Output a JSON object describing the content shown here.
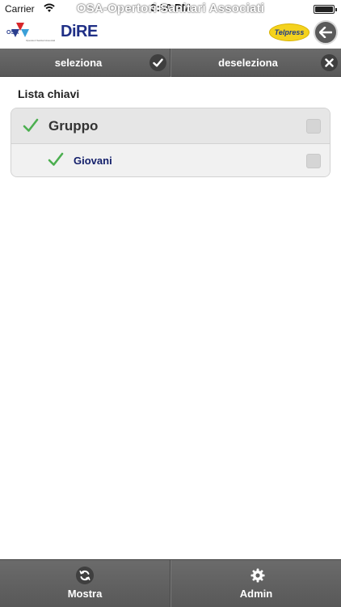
{
  "status_bar": {
    "carrier": "Carrier",
    "time": "3:50 PM",
    "wifi_icon": "wifi-icon",
    "battery_icon": "battery-icon"
  },
  "app": {
    "title": "OSA-Opertori Sanitari Associati"
  },
  "header": {
    "logo_osa_text": "OSA",
    "logo_osa_subtitle": "Operatori Sanitari Associati",
    "logo_dire_text": "DiRE",
    "logo_telpress_text": "Telpress",
    "back_icon": "arrow-left-icon"
  },
  "toolbar": {
    "select_label": "seleziona",
    "select_icon": "check-circle-icon",
    "deselect_label": "deseleziona",
    "deselect_icon": "close-circle-icon"
  },
  "content": {
    "section_title": "Lista chiavi",
    "items": [
      {
        "label": "Gruppo",
        "checked_mark": true,
        "checkbox_checked": false
      },
      {
        "label": "Giovani",
        "checked_mark": true,
        "checkbox_checked": false
      }
    ]
  },
  "tabbar": {
    "show_label": "Mostra",
    "show_icon": "refresh-icon",
    "admin_label": "Admin",
    "admin_icon": "gear-icon"
  },
  "colors": {
    "bar_gray": "#5f5f5f",
    "check_green": "#4caf50",
    "child_text": "#14206b",
    "telpress_yellow": "#f4d21e"
  }
}
